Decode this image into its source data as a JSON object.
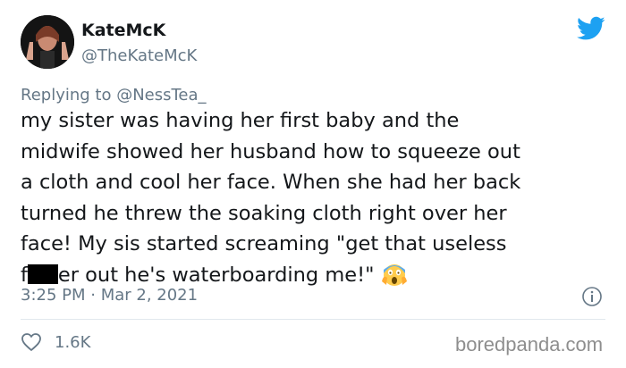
{
  "author": {
    "name": "KateMcK",
    "handle": "@TheKateMcK"
  },
  "reply": {
    "prefix": "Replying to ",
    "handle": "@NessTea_"
  },
  "tweet": {
    "lines": [
      "my sister was having her first baby and the",
      "midwife showed her husband how to squeeze out",
      "a cloth and cool her face. When she had her back",
      "turned he threw the soaking cloth right over her",
      "face! My sis started screaming \"get that useless"
    ],
    "last_line_start": "f",
    "last_line_rest": "er out he's waterboarding me!\""
  },
  "meta": {
    "timestamp": "3:25 PM · Mar 2, 2021"
  },
  "engagement": {
    "likes": "1.6K"
  },
  "watermark": "boredpanda.com",
  "icons": {
    "brand": "twitter-bird-icon",
    "info": "info-icon",
    "like": "heart-icon",
    "emoji": "screaming-face-emoji"
  },
  "colors": {
    "twitter_blue": "#1da1f2",
    "secondary_text": "#657786",
    "primary_text": "#14171a"
  }
}
